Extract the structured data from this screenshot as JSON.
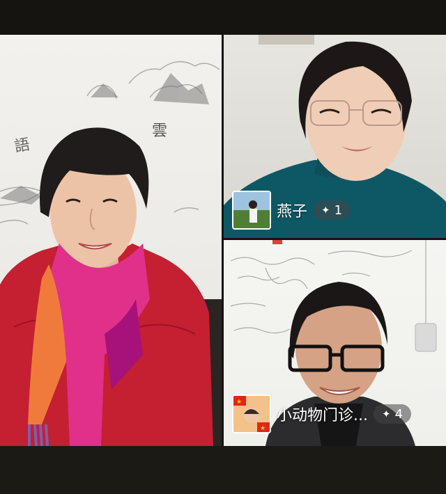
{
  "participants": [
    {
      "id": "left"
    },
    {
      "id": "right-top",
      "name": "燕子",
      "badge_icon": "sparkle-icon",
      "badge_count": "1"
    },
    {
      "id": "right-bottom",
      "name": "小动物门诊...",
      "badge_icon": "sparkle-icon",
      "badge_count": "4"
    }
  ],
  "colors": {
    "background": "#15130f",
    "badge_bg": "rgba(70,70,70,0.55)",
    "scarf_pink": "#e0308a",
    "jacket_red": "#c51f32",
    "sweater_teal": "#0e5865"
  }
}
